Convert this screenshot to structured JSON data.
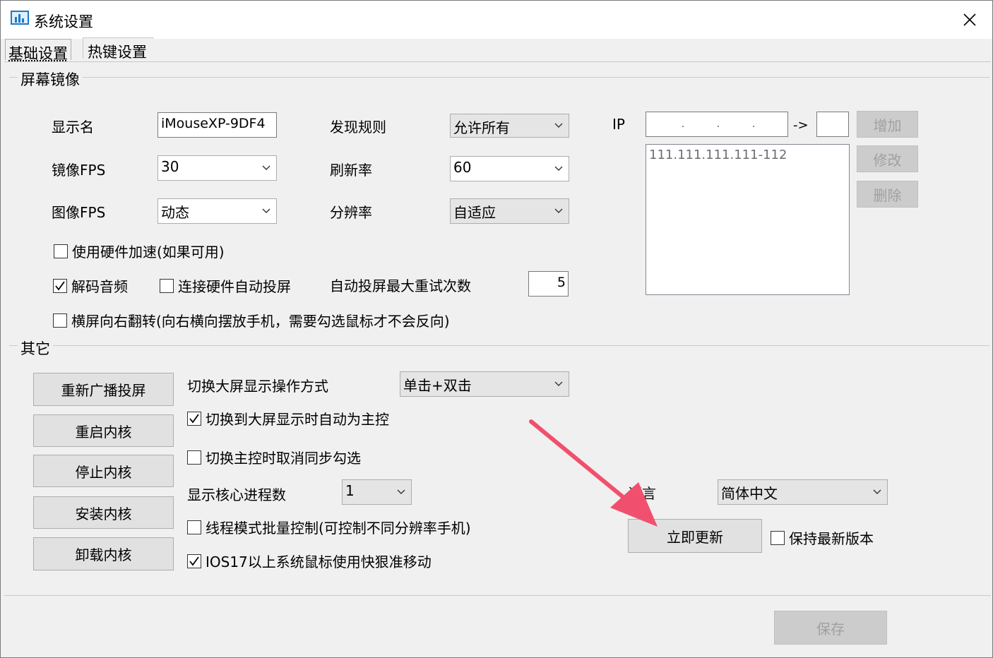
{
  "window": {
    "title": "系统设置",
    "close_glyph": "✕",
    "icon": "chart-icon"
  },
  "tabs": [
    {
      "label": "基础设置",
      "active": true
    },
    {
      "label": "热键设置",
      "active": false
    }
  ],
  "mirror": {
    "group_title": "屏幕镜像",
    "display_name_label": "显示名",
    "display_name_value": "iMouseXP-9DF4",
    "discovery_label": "发现规则",
    "discovery_value": "允许所有",
    "ip_label": "IP",
    "ip_range_arrow": "->",
    "ip_list_entry": "111.111.111.111-112",
    "add_button": "增加",
    "modify_button": "修改",
    "delete_button": "删除",
    "mirror_fps_label": "镜像FPS",
    "mirror_fps_value": "30",
    "refresh_label": "刷新率",
    "refresh_value": "60",
    "image_fps_label": "图像FPS",
    "image_fps_value": "动态",
    "resolution_label": "分辨率",
    "resolution_value": "自适应",
    "hw_accel_label": "使用硬件加速(如果可用)",
    "hw_accel_checked": false,
    "decode_audio_label": "解码音频",
    "decode_audio_checked": true,
    "auto_cast_label": "连接硬件自动投屏",
    "auto_cast_checked": false,
    "max_retry_label": "自动投屏最大重试次数",
    "max_retry_value": "5",
    "landscape_flip_label": "横屏向右翻转(向右横向摆放手机，需要勾选鼠标才不会反向)",
    "landscape_flip_checked": false
  },
  "other": {
    "group_title": "其它",
    "rebroadcast_button": "重新广播投屏",
    "restart_kernel_button": "重启内核",
    "stop_kernel_button": "停止内核",
    "install_kernel_button": "安装内核",
    "uninstall_kernel_button": "卸载内核",
    "switch_mode_label": "切换大屏显示操作方式",
    "switch_mode_value": "单击+双击",
    "auto_master_label": "切换到大屏显示时自动为主控",
    "auto_master_checked": true,
    "cancel_sync_label": "切换主控时取消同步勾选",
    "cancel_sync_checked": false,
    "core_process_label": "显示核心进程数",
    "core_process_value": "1",
    "thread_mode_label": "线程模式批量控制(可控制不同分辨率手机)",
    "thread_mode_checked": false,
    "ios17_label": "IOS17以上系统鼠标使用快狠准移动",
    "ios17_checked": true,
    "language_label": "语言",
    "language_value": "简体中文",
    "update_now_button": "立即更新",
    "keep_latest_label": "保持最新版本",
    "keep_latest_checked": false
  },
  "footer": {
    "save_button": "保存"
  },
  "colors": {
    "annotation_arrow": "#f0506e",
    "window_bg": "#f0f0f0"
  }
}
